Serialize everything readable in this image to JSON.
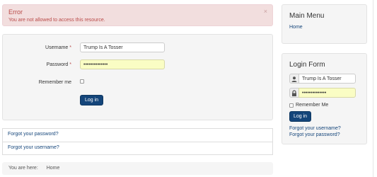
{
  "alert": {
    "title": "Error",
    "message": "You are not allowed to access this resource.",
    "close": "×"
  },
  "login": {
    "username_label": "Username",
    "username_required": "*",
    "username_value": "Trump Is A Tosser",
    "password_label": "Password",
    "password_required": "*",
    "password_value": "••••••••••••••",
    "remember_label": "Remember me",
    "submit_label": "Log in"
  },
  "links": {
    "forgot_password": "Forgot your password?",
    "forgot_username": "Forgot your username?"
  },
  "breadcrumb": {
    "prefix": "You are here:",
    "home": "Home"
  },
  "sidebar": {
    "main_menu": {
      "title": "Main Menu",
      "home": "Home"
    },
    "login_form": {
      "title": "Login Form",
      "username_value": "Trump Is A Tosser",
      "password_value": "••••••••••••••",
      "remember_label": "Remember Me",
      "submit_label": "Log in",
      "forgot_username": "Forgot your username?",
      "forgot_password": "Forgot your password?"
    }
  },
  "colors": {
    "primary": "#14457a",
    "error_bg": "#f2dede",
    "error_text": "#b94a48",
    "password_bg": "#fafdc4"
  }
}
